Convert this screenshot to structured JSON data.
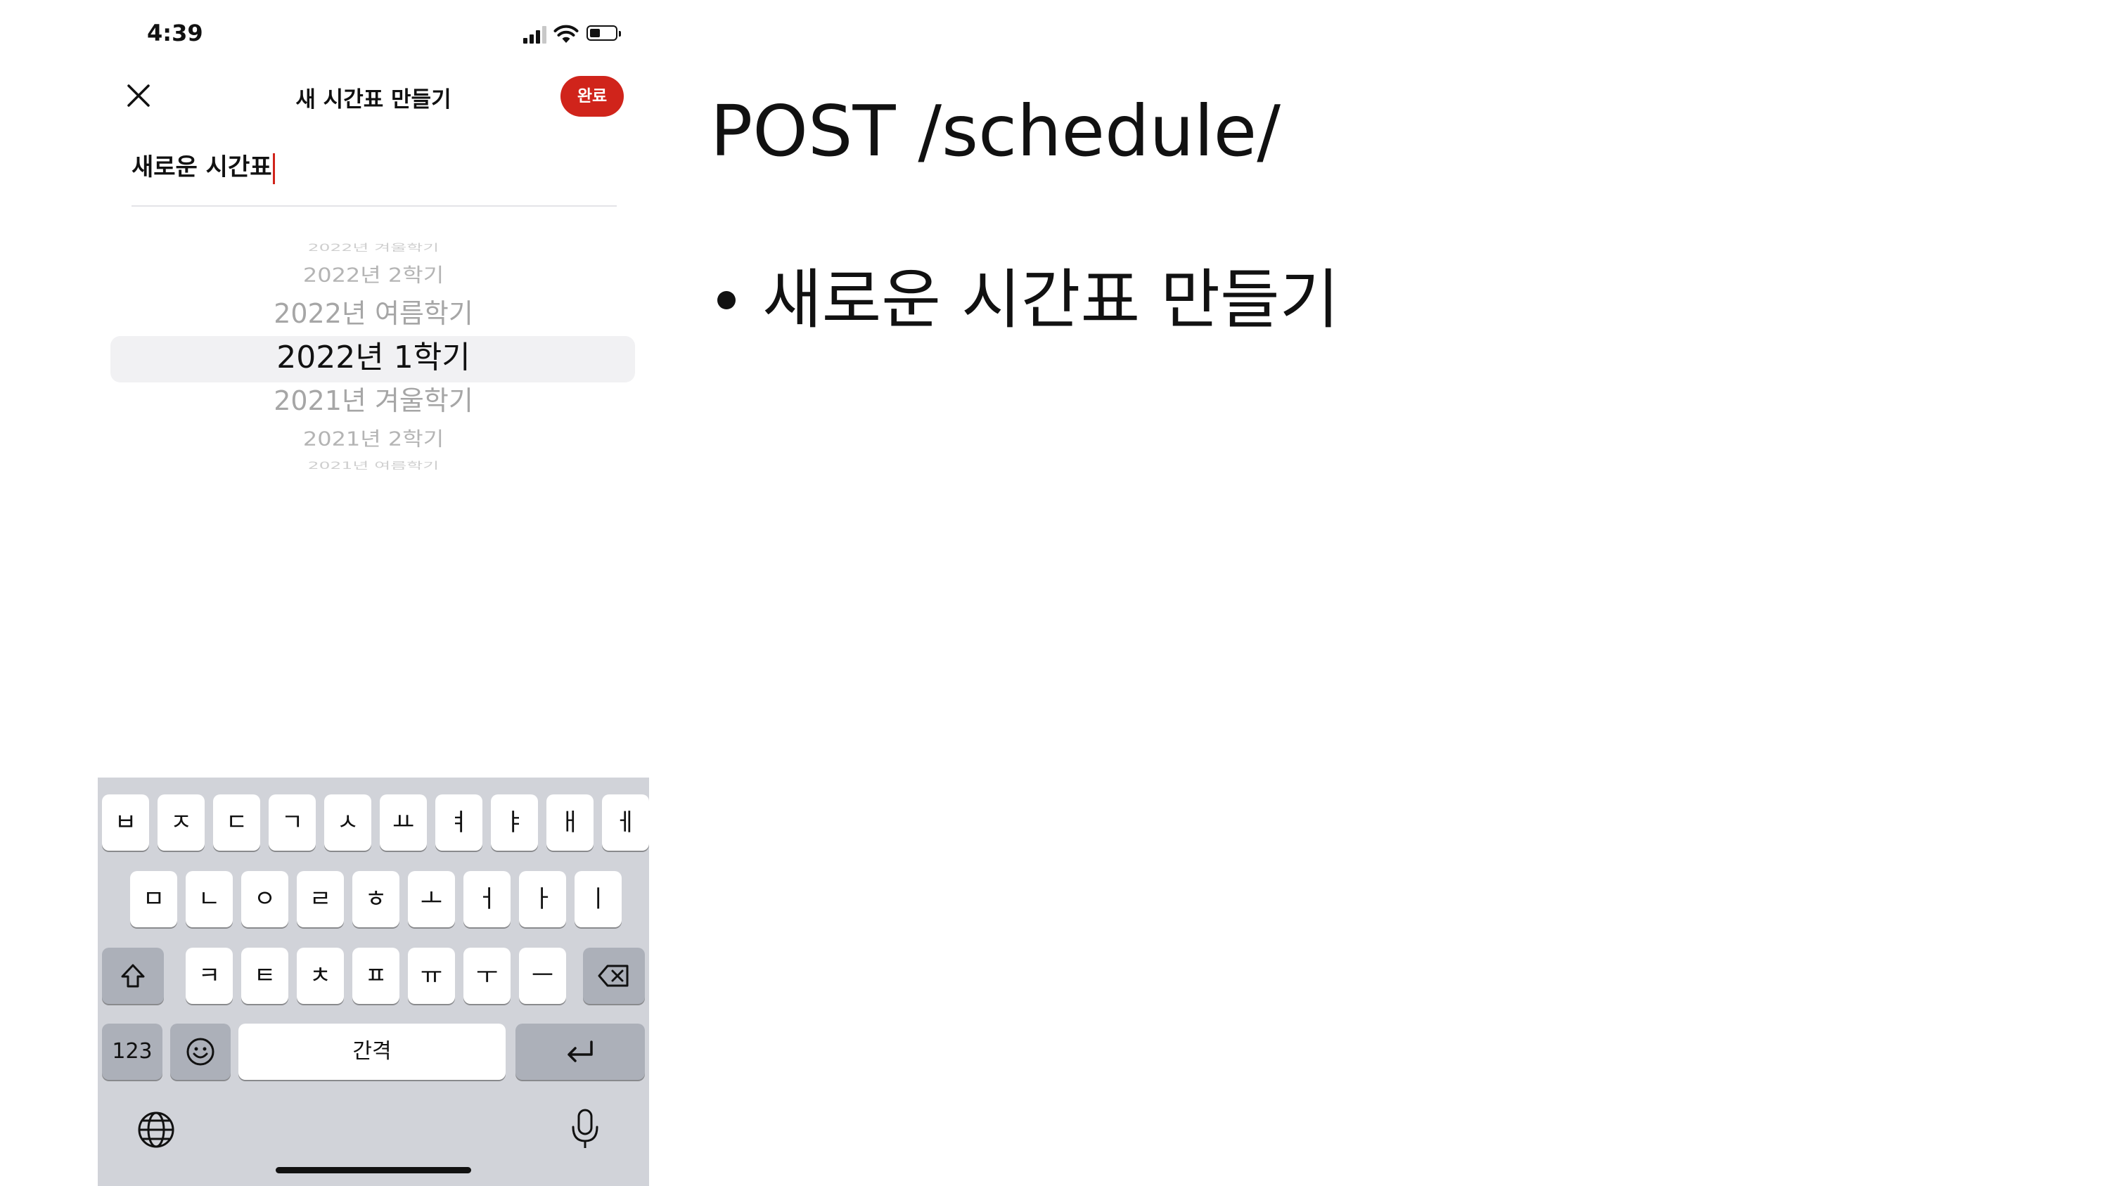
{
  "status_bar": {
    "time": "4:39"
  },
  "header": {
    "title": "새 시간표 만들기",
    "done_label": "완료"
  },
  "name_input": {
    "value": "새로운 시간표"
  },
  "semester_picker": {
    "items": [
      "2022년 겨울학기",
      "2022년 2학기",
      "2022년 여름학기",
      "2022년 1학기",
      "2021년 겨울학기",
      "2021년 2학기",
      "2021년 여름학기"
    ],
    "selected": "2022년 1학기"
  },
  "keyboard": {
    "row1": [
      "ㅂ",
      "ㅈ",
      "ㄷ",
      "ㄱ",
      "ㅅ",
      "ㅛ",
      "ㅕ",
      "ㅑ",
      "ㅐ",
      "ㅔ"
    ],
    "row2": [
      "ㅁ",
      "ㄴ",
      "ㅇ",
      "ㄹ",
      "ㅎ",
      "ㅗ",
      "ㅓ",
      "ㅏ",
      "ㅣ"
    ],
    "row3": [
      "ㅋ",
      "ㅌ",
      "ㅊ",
      "ㅍ",
      "ㅠ",
      "ㅜ",
      "ㅡ"
    ],
    "numbers_label": "123",
    "space_label": "간격"
  },
  "slide": {
    "title": "POST /schedule/",
    "bullet": "새로운 시간표 만들기"
  },
  "colors": {
    "accent": "#d0241b",
    "keyboard_bg": "#d1d3d9",
    "picker_highlight": "#f1f1f3"
  }
}
